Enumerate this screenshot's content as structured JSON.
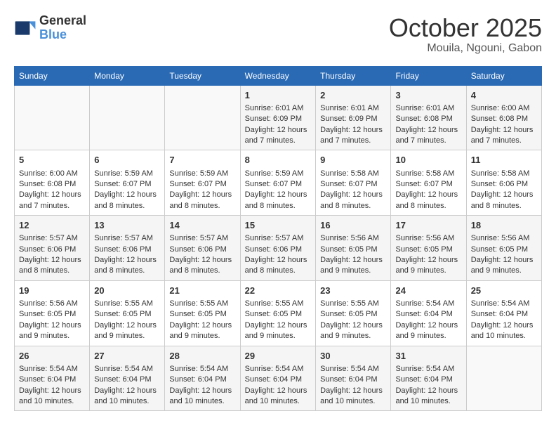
{
  "header": {
    "logo_line1": "General",
    "logo_line2": "Blue",
    "month_title": "October 2025",
    "location": "Mouila, Ngouni, Gabon"
  },
  "days_of_week": [
    "Sunday",
    "Monday",
    "Tuesday",
    "Wednesday",
    "Thursday",
    "Friday",
    "Saturday"
  ],
  "weeks": [
    [
      {
        "day": "",
        "content": ""
      },
      {
        "day": "",
        "content": ""
      },
      {
        "day": "",
        "content": ""
      },
      {
        "day": "1",
        "content": "Sunrise: 6:01 AM\nSunset: 6:09 PM\nDaylight: 12 hours and 7 minutes."
      },
      {
        "day": "2",
        "content": "Sunrise: 6:01 AM\nSunset: 6:09 PM\nDaylight: 12 hours and 7 minutes."
      },
      {
        "day": "3",
        "content": "Sunrise: 6:01 AM\nSunset: 6:08 PM\nDaylight: 12 hours and 7 minutes."
      },
      {
        "day": "4",
        "content": "Sunrise: 6:00 AM\nSunset: 6:08 PM\nDaylight: 12 hours and 7 minutes."
      }
    ],
    [
      {
        "day": "5",
        "content": "Sunrise: 6:00 AM\nSunset: 6:08 PM\nDaylight: 12 hours and 7 minutes."
      },
      {
        "day": "6",
        "content": "Sunrise: 5:59 AM\nSunset: 6:07 PM\nDaylight: 12 hours and 8 minutes."
      },
      {
        "day": "7",
        "content": "Sunrise: 5:59 AM\nSunset: 6:07 PM\nDaylight: 12 hours and 8 minutes."
      },
      {
        "day": "8",
        "content": "Sunrise: 5:59 AM\nSunset: 6:07 PM\nDaylight: 12 hours and 8 minutes."
      },
      {
        "day": "9",
        "content": "Sunrise: 5:58 AM\nSunset: 6:07 PM\nDaylight: 12 hours and 8 minutes."
      },
      {
        "day": "10",
        "content": "Sunrise: 5:58 AM\nSunset: 6:07 PM\nDaylight: 12 hours and 8 minutes."
      },
      {
        "day": "11",
        "content": "Sunrise: 5:58 AM\nSunset: 6:06 PM\nDaylight: 12 hours and 8 minutes."
      }
    ],
    [
      {
        "day": "12",
        "content": "Sunrise: 5:57 AM\nSunset: 6:06 PM\nDaylight: 12 hours and 8 minutes."
      },
      {
        "day": "13",
        "content": "Sunrise: 5:57 AM\nSunset: 6:06 PM\nDaylight: 12 hours and 8 minutes."
      },
      {
        "day": "14",
        "content": "Sunrise: 5:57 AM\nSunset: 6:06 PM\nDaylight: 12 hours and 8 minutes."
      },
      {
        "day": "15",
        "content": "Sunrise: 5:57 AM\nSunset: 6:06 PM\nDaylight: 12 hours and 8 minutes."
      },
      {
        "day": "16",
        "content": "Sunrise: 5:56 AM\nSunset: 6:05 PM\nDaylight: 12 hours and 9 minutes."
      },
      {
        "day": "17",
        "content": "Sunrise: 5:56 AM\nSunset: 6:05 PM\nDaylight: 12 hours and 9 minutes."
      },
      {
        "day": "18",
        "content": "Sunrise: 5:56 AM\nSunset: 6:05 PM\nDaylight: 12 hours and 9 minutes."
      }
    ],
    [
      {
        "day": "19",
        "content": "Sunrise: 5:56 AM\nSunset: 6:05 PM\nDaylight: 12 hours and 9 minutes."
      },
      {
        "day": "20",
        "content": "Sunrise: 5:55 AM\nSunset: 6:05 PM\nDaylight: 12 hours and 9 minutes."
      },
      {
        "day": "21",
        "content": "Sunrise: 5:55 AM\nSunset: 6:05 PM\nDaylight: 12 hours and 9 minutes."
      },
      {
        "day": "22",
        "content": "Sunrise: 5:55 AM\nSunset: 6:05 PM\nDaylight: 12 hours and 9 minutes."
      },
      {
        "day": "23",
        "content": "Sunrise: 5:55 AM\nSunset: 6:05 PM\nDaylight: 12 hours and 9 minutes."
      },
      {
        "day": "24",
        "content": "Sunrise: 5:54 AM\nSunset: 6:04 PM\nDaylight: 12 hours and 9 minutes."
      },
      {
        "day": "25",
        "content": "Sunrise: 5:54 AM\nSunset: 6:04 PM\nDaylight: 12 hours and 10 minutes."
      }
    ],
    [
      {
        "day": "26",
        "content": "Sunrise: 5:54 AM\nSunset: 6:04 PM\nDaylight: 12 hours and 10 minutes."
      },
      {
        "day": "27",
        "content": "Sunrise: 5:54 AM\nSunset: 6:04 PM\nDaylight: 12 hours and 10 minutes."
      },
      {
        "day": "28",
        "content": "Sunrise: 5:54 AM\nSunset: 6:04 PM\nDaylight: 12 hours and 10 minutes."
      },
      {
        "day": "29",
        "content": "Sunrise: 5:54 AM\nSunset: 6:04 PM\nDaylight: 12 hours and 10 minutes."
      },
      {
        "day": "30",
        "content": "Sunrise: 5:54 AM\nSunset: 6:04 PM\nDaylight: 12 hours and 10 minutes."
      },
      {
        "day": "31",
        "content": "Sunrise: 5:54 AM\nSunset: 6:04 PM\nDaylight: 12 hours and 10 minutes."
      },
      {
        "day": "",
        "content": ""
      }
    ]
  ]
}
